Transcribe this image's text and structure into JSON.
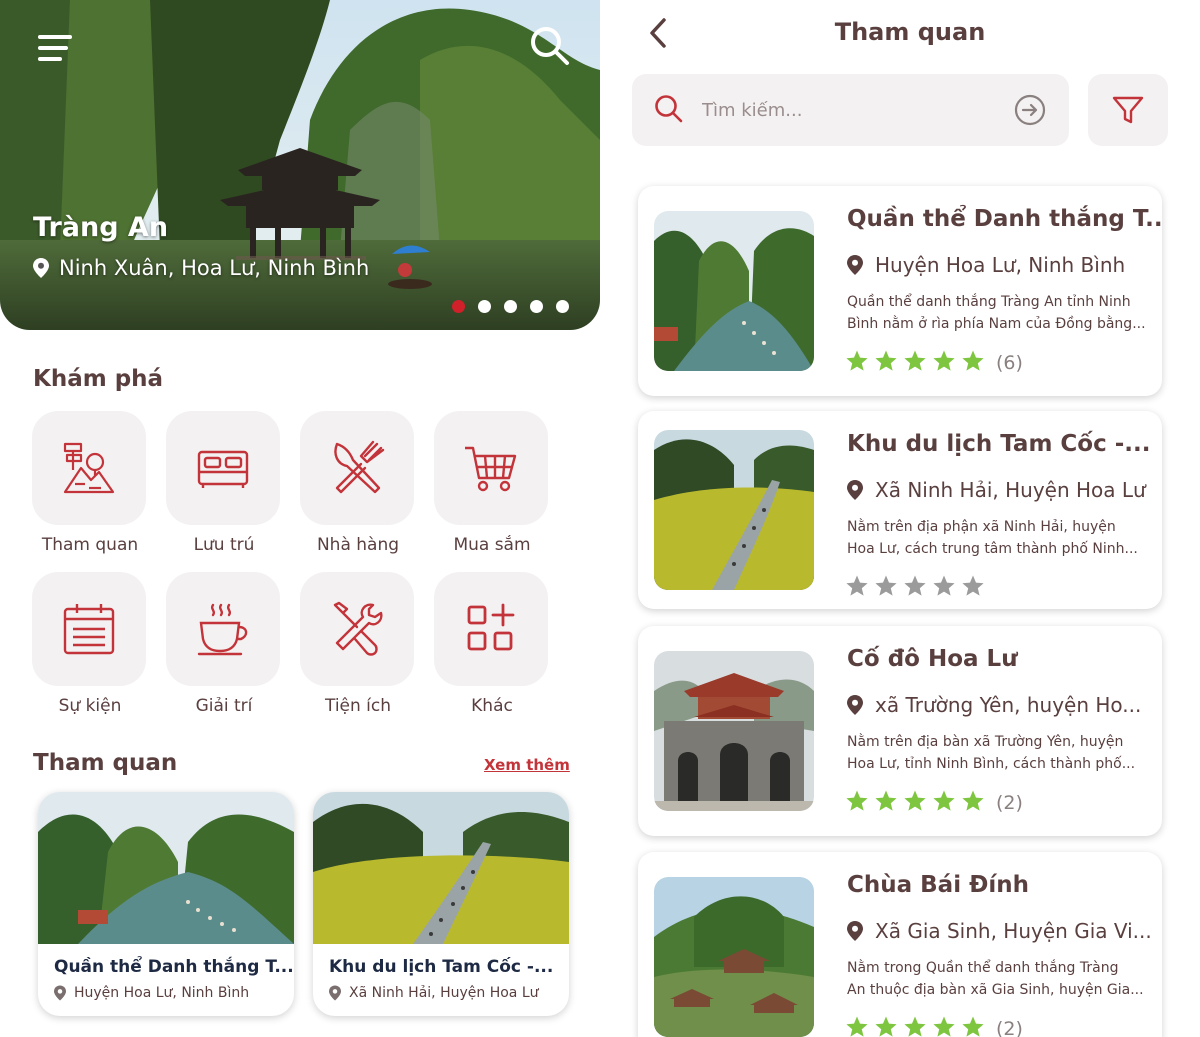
{
  "home": {
    "hero": {
      "title": "Tràng An",
      "location": "Ninh Xuân, Hoa Lư, Ninh Bình",
      "slide_count": 5,
      "active_slide": 1
    },
    "explore_title": "Khám phá",
    "categories": [
      {
        "label": "Tham quan",
        "icon": "sightseeing-icon"
      },
      {
        "label": "Lưu trú",
        "icon": "bed-icon"
      },
      {
        "label": "Nhà hàng",
        "icon": "utensils-icon"
      },
      {
        "label": "Mua sắm",
        "icon": "cart-icon"
      },
      {
        "label": "Sự kiện",
        "icon": "calendar-icon"
      },
      {
        "label": "Giải trí",
        "icon": "coffee-cup-icon"
      },
      {
        "label": "Tiện ích",
        "icon": "tools-icon"
      },
      {
        "label": "Khác",
        "icon": "grid-plus-icon"
      }
    ],
    "section_title": "Tham quan",
    "see_more": "Xem thêm",
    "places": [
      {
        "title": "Quần thể Danh thắng T...",
        "location": "Huyện Hoa Lư, Ninh Bình"
      },
      {
        "title": "Khu du lịch Tam Cốc -...",
        "location": "Xã Ninh Hải, Huyện Hoa Lư"
      }
    ]
  },
  "list": {
    "title": "Tham quan",
    "search_placeholder": "Tìm kiếm...",
    "items": [
      {
        "title": "Quần thể Danh thắng T...",
        "location": "Huyện Hoa Lư, Ninh Bình",
        "desc_line1": "Quần thể danh thắng Tràng An tỉnh Ninh",
        "desc_line2": "Bình nằm ở rìa phía Nam của Đồng bằng...",
        "stars": 5,
        "rating_count": "(6)"
      },
      {
        "title": "Khu du lịch Tam Cốc -...",
        "location": "Xã Ninh Hải, Huyện Hoa Lư",
        "desc_line1": "Nằm trên địa phận xã Ninh Hải, huyện",
        "desc_line2": "Hoa Lư, cách trung tâm thành phố Ninh...",
        "stars": 0,
        "rating_count": ""
      },
      {
        "title": "Cố đô Hoa Lư",
        "location": "xã Trường Yên, huyện Ho...",
        "desc_line1": "Nằm trên địa bàn xã Trường Yên, huyện",
        "desc_line2": "Hoa Lư, tỉnh Ninh Bình, cách thành phố...",
        "stars": 5,
        "rating_count": "(2)"
      },
      {
        "title": "Chùa Bái Đính",
        "location": "Xã Gia Sinh, Huyện Gia Vi...",
        "desc_line1": "Nằm trong Quần thể danh thắng Tràng",
        "desc_line2": "An thuộc địa bàn xã Gia Sinh, huyện Gia...",
        "stars": 5,
        "rating_count": "(2)"
      }
    ]
  },
  "colors": {
    "accent_red": "#c3343a",
    "text_brown": "#5a3f3f",
    "star_green": "#7ec63f",
    "star_gray": "#9b9b9b",
    "tile_bg": "#f3f1f1"
  }
}
